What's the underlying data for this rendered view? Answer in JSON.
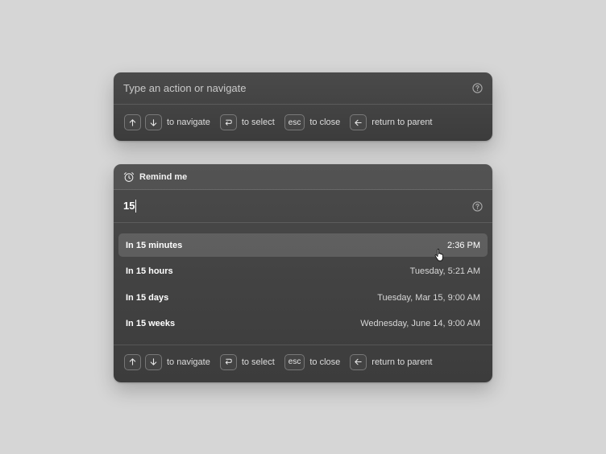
{
  "command_bar": {
    "placeholder": "Type an action or navigate",
    "help_icon": "help-circle-icon"
  },
  "footer_hints": {
    "navigate": "to navigate",
    "esc_key": "esc",
    "select": "to select",
    "close": "to close",
    "return": "return to parent"
  },
  "reminder": {
    "title": "Remind me",
    "title_icon": "alarm-clock-icon",
    "input_value": "15",
    "results": [
      {
        "label": "In 15 minutes",
        "time": "2:36 PM",
        "selected": true
      },
      {
        "label": "In 15 hours",
        "time": "Tuesday, 5:21 AM",
        "selected": false
      },
      {
        "label": "In 15 days",
        "time": "Tuesday, Mar 15, 9:00 AM",
        "selected": false
      },
      {
        "label": "In 15 weeks",
        "time": "Wednesday, June 14, 9:00 AM",
        "selected": false
      }
    ]
  },
  "colors": {
    "panel_bg": "#434343",
    "page_bg": "#d6d6d6",
    "text": "#ffffff",
    "muted_text": "#c9c9c9"
  }
}
